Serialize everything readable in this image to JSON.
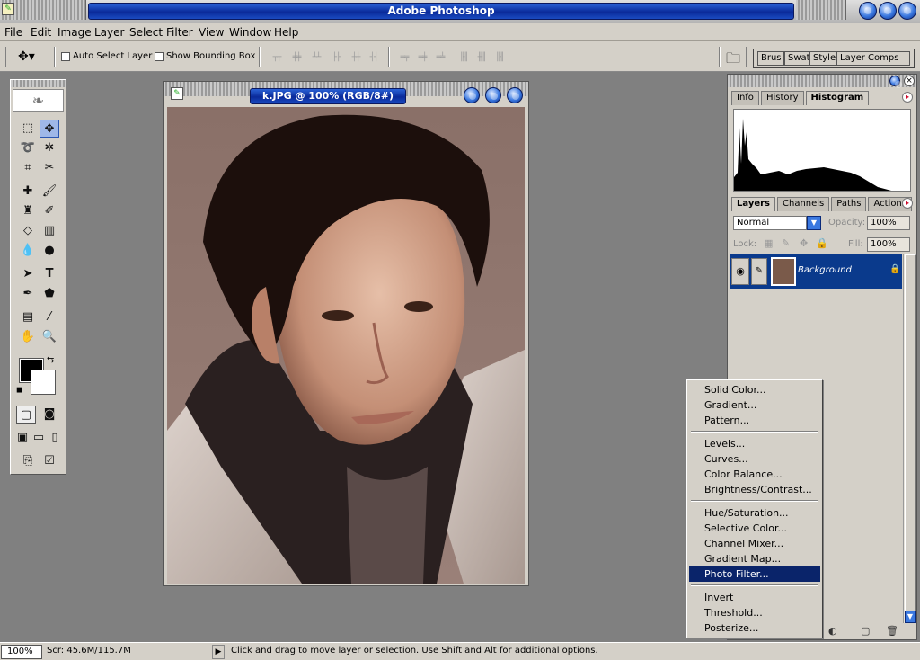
{
  "app": {
    "title": "Adobe Photoshop",
    "icon": "photoshop-feather-icon"
  },
  "menu": [
    "File",
    "Edit",
    "Image",
    "Layer",
    "Select",
    "Filter",
    "View",
    "Window",
    "Help"
  ],
  "options": {
    "auto_select_layer": "Auto Select Layer",
    "show_bounding_box": "Show Bounding Box"
  },
  "well_tabs": [
    "Brus",
    "Swat",
    "Style",
    "Layer Comps"
  ],
  "document": {
    "title": "k.JPG @ 100% (RGB/8#)"
  },
  "panel_top_tabs": [
    "Info",
    "History",
    "Histogram"
  ],
  "panel_layer_tabs": [
    "Layers",
    "Channels",
    "Paths",
    "Actions"
  ],
  "layers": {
    "blend_mode": "Normal",
    "opacity_label": "Opacity:",
    "opacity_value": "100%",
    "lock_label": "Lock:",
    "fill_label": "Fill:",
    "fill_value": "100%",
    "background_layer": "Background"
  },
  "adjustment_menu": {
    "group1": [
      "Solid Color...",
      "Gradient...",
      "Pattern..."
    ],
    "group2": [
      "Levels...",
      "Curves...",
      "Color Balance...",
      "Brightness/Contrast..."
    ],
    "group3": [
      "Hue/Saturation...",
      "Selective Color...",
      "Channel Mixer...",
      "Gradient Map...",
      "Photo Filter..."
    ],
    "group4": [
      "Invert",
      "Threshold...",
      "Posterize..."
    ],
    "highlighted": "Photo Filter..."
  },
  "status": {
    "zoom": "100%",
    "scratch": "Scr: 45.6M/115.7M",
    "hint": "Click and drag to move layer or selection.  Use Shift and Alt for additional options."
  },
  "colors": {
    "title_blue": "#0a2a9a",
    "menu_highlight": "#0a246a",
    "layer_selected": "#0a3a8c",
    "workspace": "#808080",
    "chrome": "#d4d0c8"
  }
}
